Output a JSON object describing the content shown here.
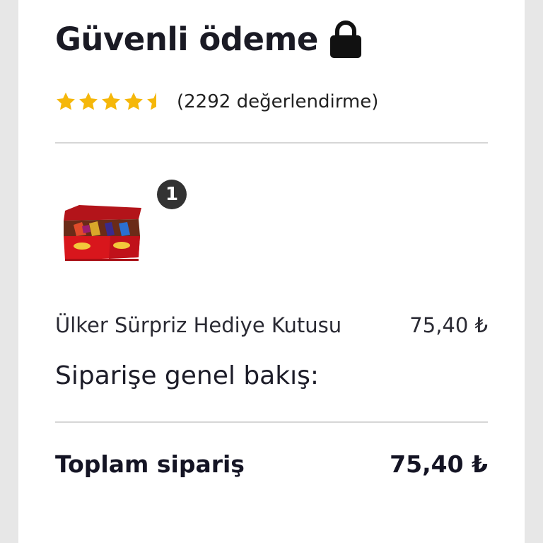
{
  "header": {
    "title": "Güvenli ödeme",
    "lock_icon": "lock-icon"
  },
  "rating": {
    "stars": 4.5,
    "max_stars": 5,
    "star_color": "#f5b70a",
    "text": "(2292 değerlendirme)"
  },
  "product": {
    "quantity_badge": "1",
    "image": "product-gift-box-image",
    "name": "Ülker Sürpriz Hediye Kutusu",
    "price": "75,40 ₺"
  },
  "summary": {
    "title": "Siparişe genel bakış:",
    "total_label": "Toplam sipariş",
    "total_value": "75,40 ₺"
  },
  "colors": {
    "page_bg": "#e7e7e7",
    "card_bg": "#ffffff",
    "text": "#1c1c28",
    "divider": "#d6d6d6",
    "badge_bg": "#333333",
    "product_red": "#d8161c"
  }
}
